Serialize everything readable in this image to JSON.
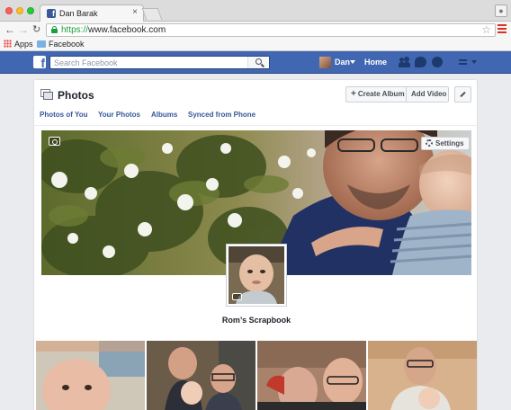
{
  "browser": {
    "tab_title": "Dan Barak",
    "tab_close": "×",
    "url_scheme": "https://",
    "url_host": "www.facebook.com",
    "bookmarks": [
      {
        "label": "Apps",
        "icon": "apps-grid-icon"
      },
      {
        "label": "Facebook",
        "icon": "folder-icon"
      }
    ]
  },
  "fb": {
    "logo_letter": "f",
    "search_placeholder": "Search Facebook",
    "user_name": "Dan",
    "home_label": "Home",
    "brand_color": "#4267b2"
  },
  "photos": {
    "title": "Photos",
    "create_album": "Create Album",
    "add_video": "Add Video",
    "tabs": [
      "Photos of You",
      "Your Photos",
      "Albums",
      "Synced from Phone"
    ],
    "cover_settings": "Settings",
    "album_name": "Rom’s Scrapbook"
  }
}
